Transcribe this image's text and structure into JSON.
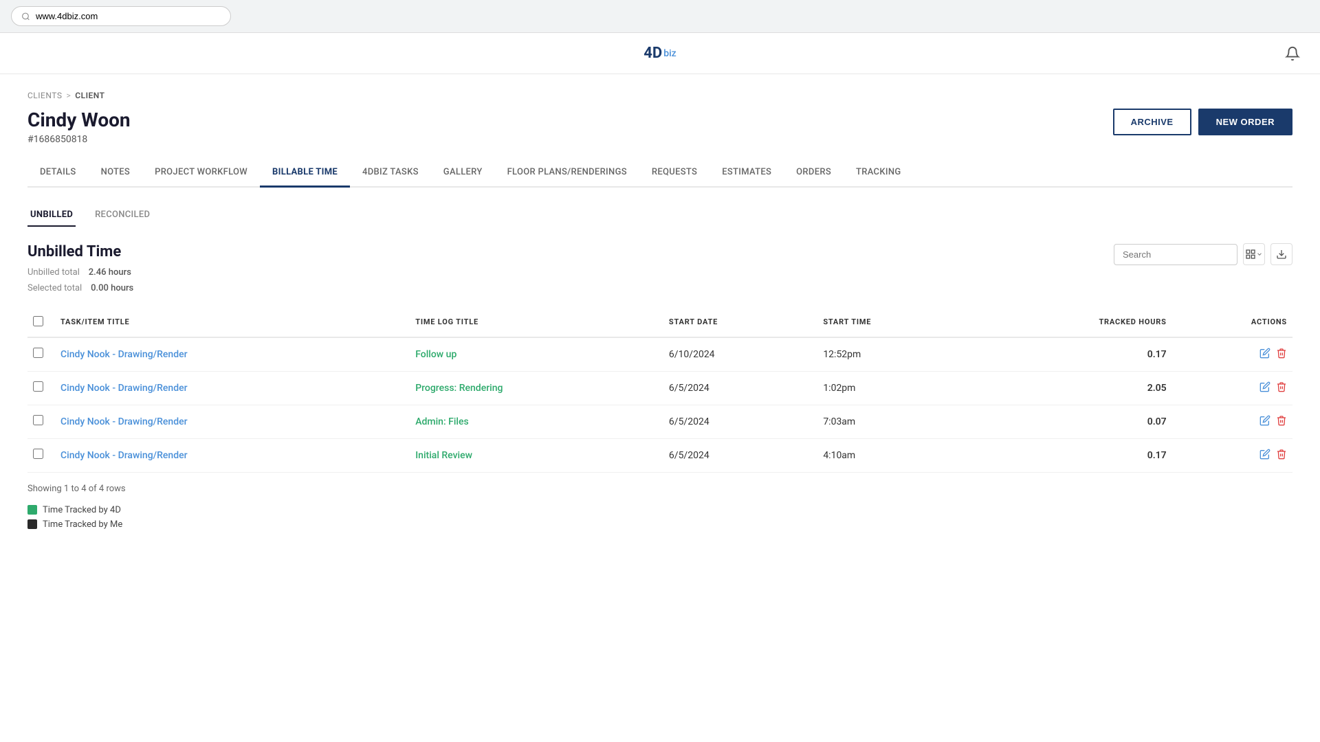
{
  "browser": {
    "url": "www.4dbiz.com"
  },
  "app": {
    "logo_4d": "4D",
    "logo_biz": "biz"
  },
  "breadcrumb": {
    "parent": "CLIENTS",
    "separator": ">",
    "current": "CLIENT"
  },
  "client": {
    "name": "Cindy Woon",
    "id": "#1686850818"
  },
  "buttons": {
    "archive": "ARCHIVE",
    "new_order": "NEW ORDER"
  },
  "main_tabs": [
    {
      "id": "details",
      "label": "DETAILS"
    },
    {
      "id": "notes",
      "label": "NOTES"
    },
    {
      "id": "project_workflow",
      "label": "PROJECT WORKFLOW"
    },
    {
      "id": "billable_time",
      "label": "BILLABLE TIME",
      "active": true
    },
    {
      "id": "4dbiz_tasks",
      "label": "4DBIZ TASKS"
    },
    {
      "id": "gallery",
      "label": "GALLERY"
    },
    {
      "id": "floor_plans",
      "label": "FLOOR PLANS/RENDERINGS"
    },
    {
      "id": "requests",
      "label": "REQUESTS"
    },
    {
      "id": "estimates",
      "label": "ESTIMATES"
    },
    {
      "id": "orders",
      "label": "ORDERS"
    },
    {
      "id": "tracking",
      "label": "TRACKING"
    }
  ],
  "sub_tabs": [
    {
      "id": "unbilled",
      "label": "UNBILLED",
      "active": true
    },
    {
      "id": "reconciled",
      "label": "RECONCILED"
    }
  ],
  "section": {
    "title": "Unbilled Time",
    "unbilled_label": "Unbilled total",
    "unbilled_value": "2.46 hours",
    "selected_label": "Selected total",
    "selected_value": "0.00 hours"
  },
  "search": {
    "placeholder": "Search"
  },
  "table": {
    "columns": [
      {
        "id": "task_title",
        "label": "TASK/ITEM TITLE"
      },
      {
        "id": "time_log_title",
        "label": "TIME LOG TITLE"
      },
      {
        "id": "start_date",
        "label": "START DATE"
      },
      {
        "id": "start_time",
        "label": "START TIME"
      },
      {
        "id": "tracked_hours",
        "label": "TRACKED HOURS"
      },
      {
        "id": "actions",
        "label": "ACTIONS"
      }
    ],
    "rows": [
      {
        "task_title": "Cindy Nook - Drawing/Render",
        "time_log_title": "Follow up",
        "start_date": "6/10/2024",
        "start_time": "12:52pm",
        "tracked_hours": "0.17"
      },
      {
        "task_title": "Cindy Nook - Drawing/Render",
        "time_log_title": "Progress: Rendering",
        "start_date": "6/5/2024",
        "start_time": "1:02pm",
        "tracked_hours": "2.05"
      },
      {
        "task_title": "Cindy Nook - Drawing/Render",
        "time_log_title": "Admin: Files",
        "start_date": "6/5/2024",
        "start_time": "7:03am",
        "tracked_hours": "0.07"
      },
      {
        "task_title": "Cindy Nook - Drawing/Render",
        "time_log_title": "Initial Review",
        "start_date": "6/5/2024",
        "start_time": "4:10am",
        "tracked_hours": "0.17"
      }
    ],
    "showing_rows": "Showing 1 to 4 of 4 rows"
  },
  "legend": [
    {
      "id": "4d",
      "label": "Time Tracked by 4D",
      "color": "green"
    },
    {
      "id": "me",
      "label": "Time Tracked by Me",
      "color": "dark"
    }
  ]
}
